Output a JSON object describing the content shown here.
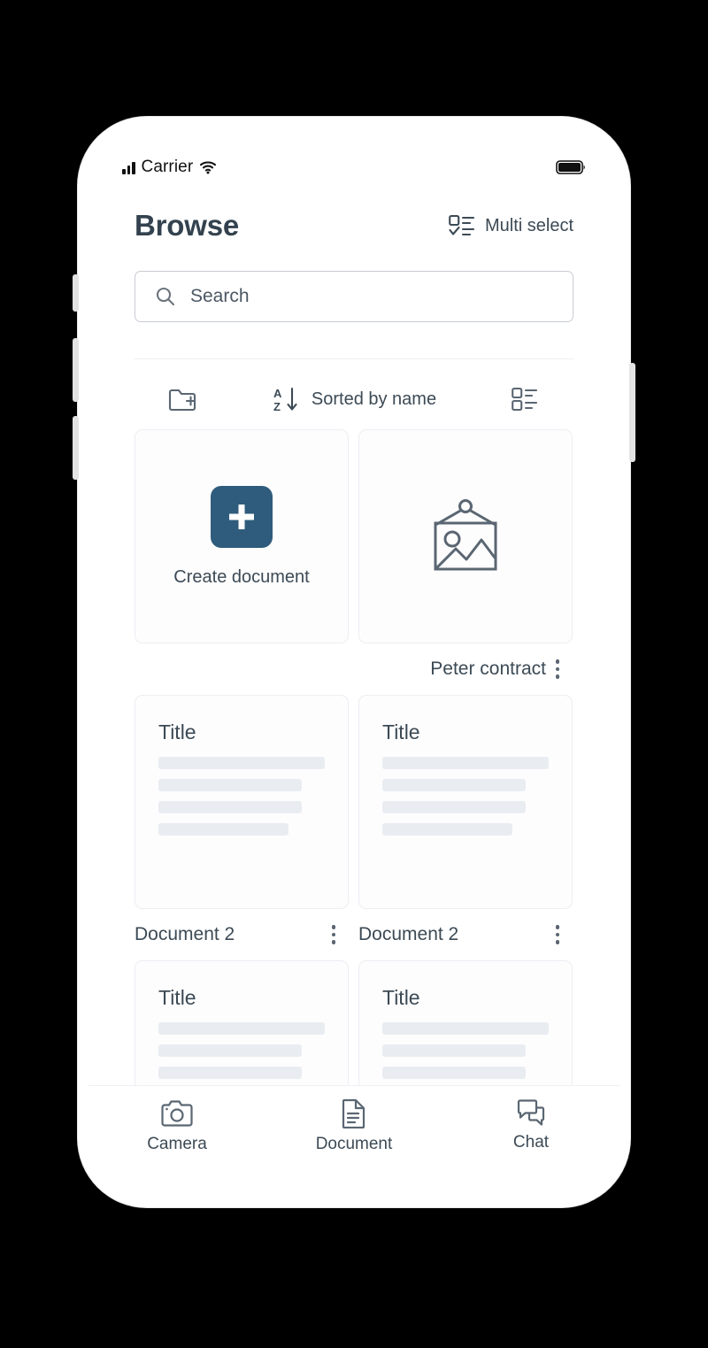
{
  "colors": {
    "accent": "#2f5c7c",
    "text_primary": "#3c4a55",
    "icon_stroke": "#5a6672",
    "card_border": "#eceef2",
    "skeleton": "#e9edf1",
    "phone_body": "#ffffff",
    "backdrop": "#000000"
  },
  "status_bar": {
    "carrier": "Carrier",
    "signal_icon": "signal-bars-icon",
    "wifi_icon": "wifi-icon",
    "battery_icon": "battery-full-icon"
  },
  "header": {
    "title": "Browse",
    "multi_select_label": "Multi select",
    "multi_select_icon": "multi-select-icon"
  },
  "search": {
    "placeholder": "Search",
    "value": "",
    "icon": "search-icon"
  },
  "toolbar": {
    "new_folder_icon": "new-folder-icon",
    "sort_icon": "sort-az-descending-icon",
    "sort_label": "Sorted by name",
    "view_toggle_icon": "list-view-icon"
  },
  "grid": {
    "items": [
      {
        "type": "create",
        "label": "Create document",
        "icon": "plus-icon",
        "caption": "",
        "has_kebab": false
      },
      {
        "type": "image",
        "label": "",
        "icon": "picture-frame-icon",
        "caption": "Peter contract",
        "has_kebab": true
      },
      {
        "type": "document",
        "preview_title": "Title",
        "caption": "Document 2",
        "has_kebab": true
      },
      {
        "type": "document",
        "preview_title": "Title",
        "caption": "Document 2",
        "has_kebab": true
      },
      {
        "type": "document",
        "preview_title": "Title",
        "caption": "",
        "has_kebab": false
      },
      {
        "type": "document",
        "preview_title": "Title",
        "caption": "",
        "has_kebab": false
      }
    ]
  },
  "tabbar": {
    "tabs": [
      {
        "label": "Camera",
        "icon": "camera-icon"
      },
      {
        "label": "Document",
        "icon": "document-icon"
      },
      {
        "label": "Chat",
        "icon": "chat-bubbles-icon"
      }
    ]
  }
}
